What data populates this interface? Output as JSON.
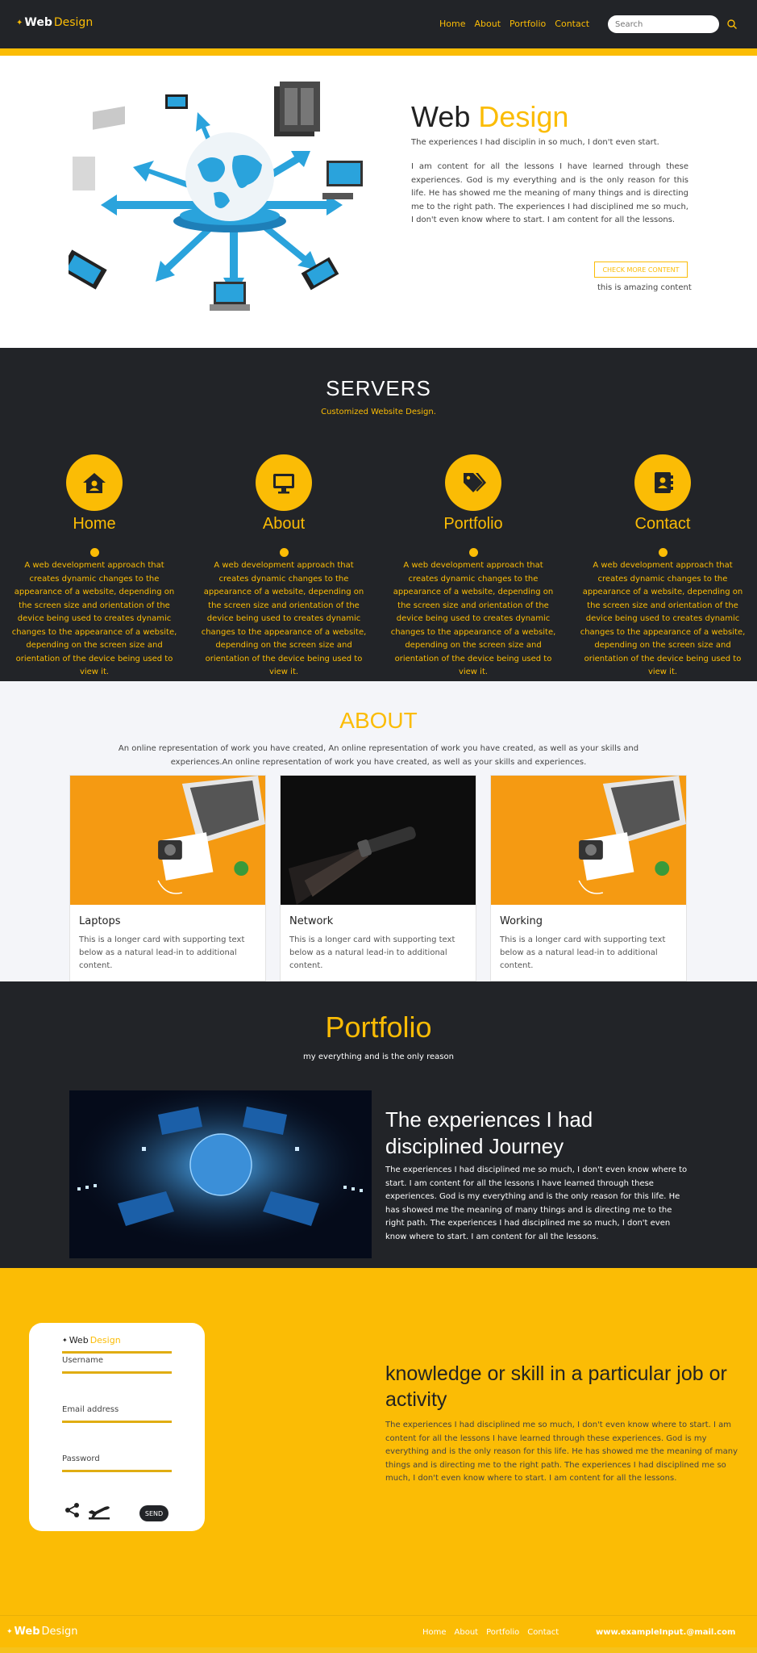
{
  "colors": {
    "accent": "#fbbc05",
    "dark": "#222428",
    "light": "#f4f5f9",
    "white": "#ffffff"
  },
  "navbar": {
    "brand_bold": "Web",
    "brand_light": "Design",
    "links": [
      "Home",
      "About",
      "Portfolio",
      "Contact"
    ],
    "search_placeholder": "Search",
    "search_icon": "search-icon"
  },
  "hero": {
    "title_dark": "Web",
    "title_accent": "Design",
    "subtitle": "The experiences I had disciplin in so much, I don't even start.",
    "paragraph": "I am content for all the lessons I have learned through these experiences. God is my everything and is the only reason for this life. He has showed me the meaning of many things and is directing me to the right path. The experiences I had disciplined me so much, I don't even know where to start. I am content for all the lessons.",
    "button": "CHECK MORE CONTENT",
    "note": "this is amazing content",
    "image": "network-globe-devices-illustration"
  },
  "servers": {
    "title": "SERVERS",
    "subtitle": "Customized Website Design.",
    "items": [
      {
        "icon": "home-icon",
        "name": "Home",
        "text": "A web development approach that creates dynamic changes to the appearance of a website, depending on the screen size and orientation of the device being used to creates dynamic changes to the appearance of a website, depending on the screen size and orientation of the device being used to view it."
      },
      {
        "icon": "monitor-icon",
        "name": "About",
        "text": "A web development approach that creates dynamic changes to the appearance of a website, depending on the screen size and orientation of the device being used to creates dynamic changes to the appearance of a website, depending on the screen size and orientation of the device being used to view it."
      },
      {
        "icon": "tags-icon",
        "name": "Portfolio",
        "text": "A web development approach that creates dynamic changes to the appearance of a website, depending on the screen size and orientation of the device being used to creates dynamic changes to the appearance of a website, depending on the screen size and orientation of the device being used to view it."
      },
      {
        "icon": "contact-book-icon",
        "name": "Contact",
        "text": "A web development approach that creates dynamic changes to the appearance of a website, depending on the screen size and orientation of the device being used to creates dynamic changes to the appearance of a website, depending on the screen size and orientation of the device being used to view it."
      }
    ]
  },
  "about": {
    "title": "ABOUT",
    "subtitle": "An online representation of work you have created, An online representation of work you have created, as well as your skills and experiences.An online representation of work you have created, as well as your skills and experiences.",
    "cards": [
      {
        "image": "laptop-camera-orange-desk",
        "title": "Laptops",
        "text": "This is a longer card with supporting text below as a natural lead-in to additional content."
      },
      {
        "image": "flashlight-dark",
        "title": "Network",
        "text": "This is a longer card with supporting text below as a natural lead-in to additional content."
      },
      {
        "image": "laptop-camera-orange-desk",
        "title": "Working",
        "text": "This is a longer card with supporting text below as a natural lead-in to additional content."
      }
    ]
  },
  "portfolio": {
    "title": "Portfolio",
    "subtitle": "my everything and is the only reason",
    "heading": "The experiences I had disciplined Journey",
    "text": "The experiences I had disciplined me so much, I don't even know where to start. I am content for all the lessons I have learned through these experiences. God is my everything and is the only reason for this life. He has showed me the meaning of many things and is directing me to the right path. The experiences I had disciplined me so much, I don't even know where to start. I am content for all the lessons.",
    "image": "digital-globe-network"
  },
  "contact": {
    "form_brand_dark": "Web",
    "form_brand_accent": "Design",
    "username_label": "Username",
    "email_label": "Email address",
    "password_label": "Password",
    "send": "SEND",
    "icons": [
      "share-icon",
      "plane-icon"
    ],
    "heading": "knowledge or skill in a particular job or activity",
    "text": "The experiences I had disciplined me so much, I don't even know where to start. I am content for all the lessons I have learned through these experiences. God is my everything and is the only reason for this life. He has showed me the meaning of many things and is directing me to the right path. The experiences I had disciplined me so much, I don't even know where to start. I am content for all the lessons."
  },
  "footer": {
    "brand_bold": "Web",
    "brand_light": "Design",
    "links": [
      "Home",
      "About",
      "Portfolio",
      "Contact"
    ],
    "email": "www.exampleInput.@mail.com"
  }
}
